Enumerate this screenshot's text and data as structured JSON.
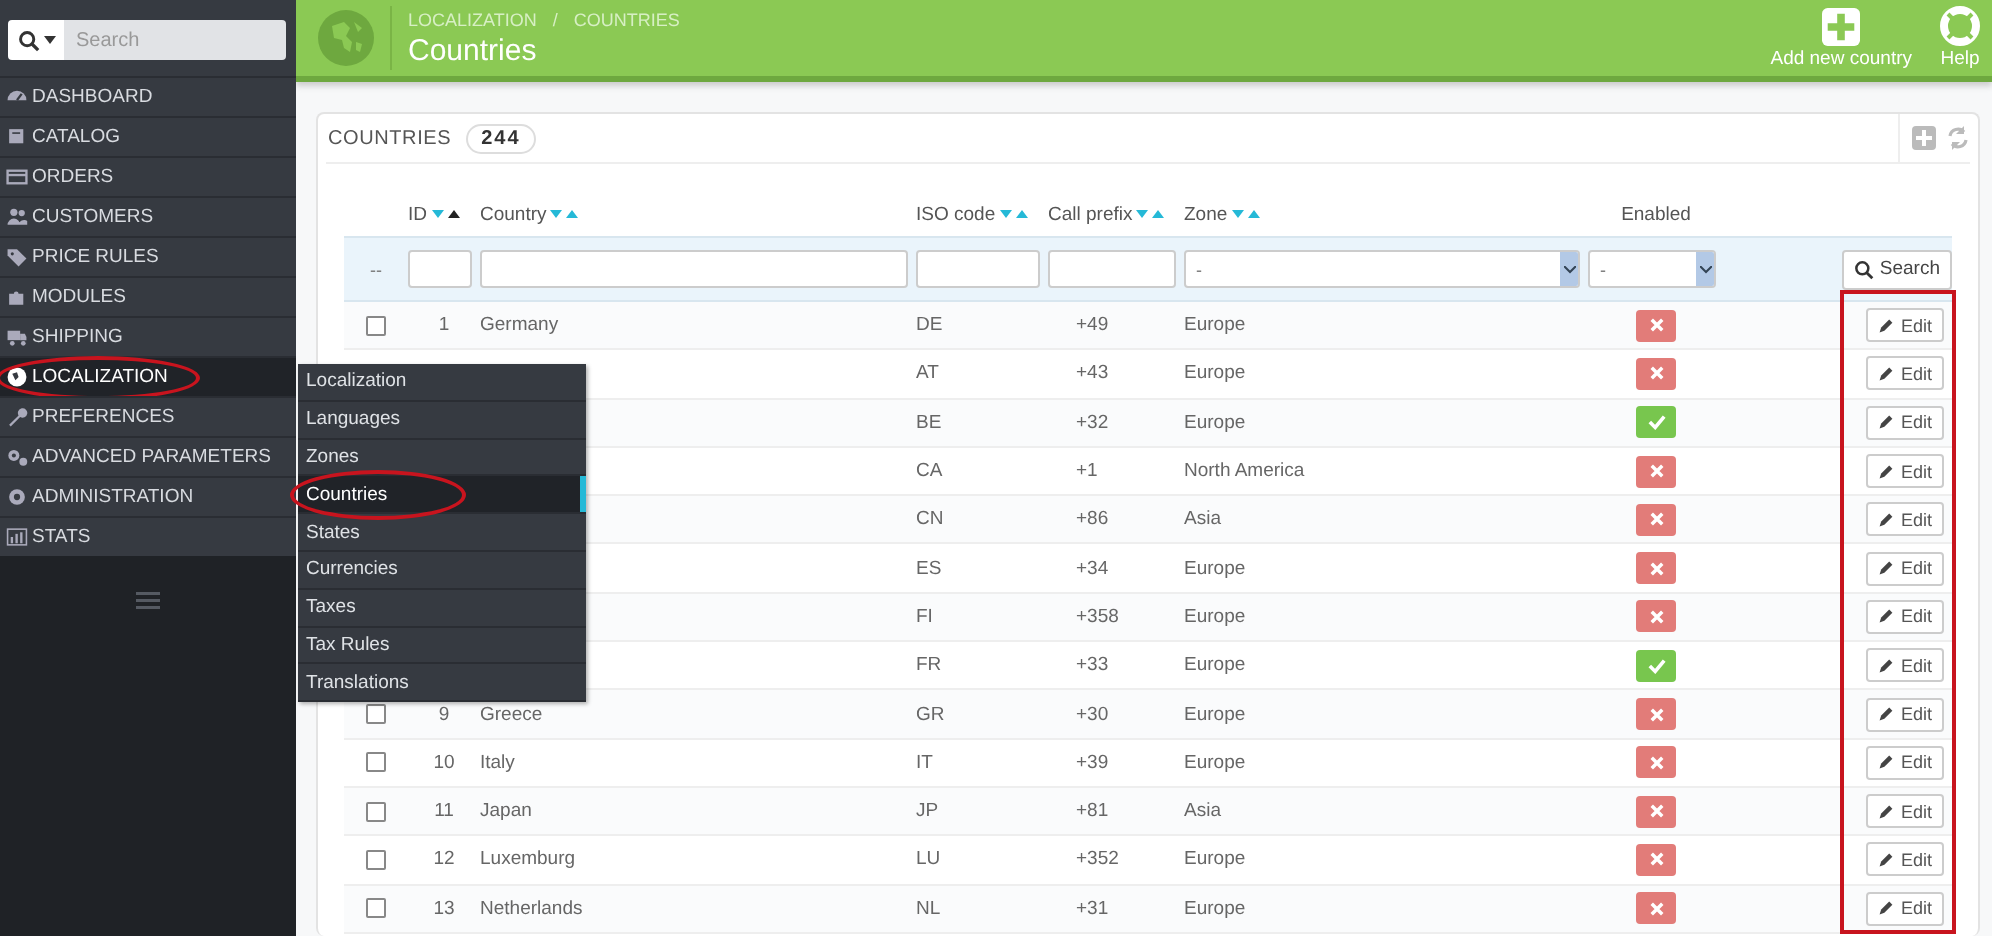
{
  "sidebar": {
    "search": {
      "placeholder": "Search"
    },
    "items": [
      {
        "label": "DASHBOARD",
        "selected": false,
        "circled": false
      },
      {
        "label": "CATALOG",
        "selected": false,
        "circled": false
      },
      {
        "label": "ORDERS",
        "selected": false,
        "circled": false
      },
      {
        "label": "CUSTOMERS",
        "selected": false,
        "circled": false
      },
      {
        "label": "PRICE RULES",
        "selected": false,
        "circled": false
      },
      {
        "label": "MODULES",
        "selected": false,
        "circled": false
      },
      {
        "label": "SHIPPING",
        "selected": false,
        "circled": false
      },
      {
        "label": "LOCALIZATION",
        "selected": true,
        "circled": true
      },
      {
        "label": "PREFERENCES",
        "selected": false,
        "circled": false
      },
      {
        "label": "ADVANCED PARAMETERS",
        "selected": false,
        "circled": false
      },
      {
        "label": "ADMINISTRATION",
        "selected": false,
        "circled": false
      },
      {
        "label": "STATS",
        "selected": false,
        "circled": false
      }
    ]
  },
  "submenu": {
    "items": [
      {
        "label": "Localization",
        "selected": false,
        "circled": false
      },
      {
        "label": "Languages",
        "selected": false,
        "circled": false
      },
      {
        "label": "Zones",
        "selected": false,
        "circled": false
      },
      {
        "label": "Countries",
        "selected": true,
        "circled": true
      },
      {
        "label": "States",
        "selected": false,
        "circled": false
      },
      {
        "label": "Currencies",
        "selected": false,
        "circled": false
      },
      {
        "label": "Taxes",
        "selected": false,
        "circled": false
      },
      {
        "label": "Tax Rules",
        "selected": false,
        "circled": false
      },
      {
        "label": "Translations",
        "selected": false,
        "circled": false
      }
    ]
  },
  "header": {
    "breadcrumb": [
      "LOCALIZATION",
      "COUNTRIES"
    ],
    "separator": "/",
    "title": "Countries",
    "toolbar": [
      {
        "kind": "add",
        "label": "Add new country"
      },
      {
        "kind": "help",
        "label": "Help"
      }
    ]
  },
  "panel": {
    "title": "COUNTRIES",
    "count": "244",
    "columns": [
      {
        "label": "ID",
        "sort_ascending": true
      },
      {
        "label": "Country",
        "sort_ascending": false
      },
      {
        "label": "ISO code",
        "sort_ascending": false
      },
      {
        "label": "Call prefix",
        "sort_ascending": false
      },
      {
        "label": "Zone",
        "sort_ascending": false
      },
      {
        "label": "Enabled"
      }
    ],
    "filters": {
      "marker": "--",
      "zone": "-",
      "enabled": "-",
      "search_button": "Search"
    },
    "edit_column_framed": true,
    "rows": [
      {
        "selected": false,
        "id": "1",
        "country": "Germany",
        "iso": "DE",
        "prefix": "+49",
        "zone": "Europe",
        "enabled": false,
        "action": "Edit"
      },
      {
        "iso": "AT",
        "prefix": "+43",
        "zone": "Europe",
        "enabled": false,
        "action": "Edit"
      },
      {
        "iso": "BE",
        "prefix": "+32",
        "zone": "Europe",
        "enabled": true,
        "action": "Edit"
      },
      {
        "iso": "CA",
        "prefix": "+1",
        "zone": "North America",
        "enabled": false,
        "action": "Edit"
      },
      {
        "iso": "CN",
        "prefix": "+86",
        "zone": "Asia",
        "enabled": false,
        "action": "Edit"
      },
      {
        "iso": "ES",
        "prefix": "+34",
        "zone": "Europe",
        "enabled": false,
        "action": "Edit"
      },
      {
        "iso": "FI",
        "prefix": "+358",
        "zone": "Europe",
        "enabled": false,
        "action": "Edit"
      },
      {
        "iso": "FR",
        "prefix": "+33",
        "zone": "Europe",
        "enabled": true,
        "action": "Edit"
      },
      {
        "selected": false,
        "id": "9",
        "country": "Greece",
        "iso": "GR",
        "prefix": "+30",
        "zone": "Europe",
        "enabled": false,
        "action": "Edit"
      },
      {
        "selected": false,
        "id": "10",
        "country": "Italy",
        "iso": "IT",
        "prefix": "+39",
        "zone": "Europe",
        "enabled": false,
        "action": "Edit"
      },
      {
        "selected": false,
        "id": "11",
        "country": "Japan",
        "iso": "JP",
        "prefix": "+81",
        "zone": "Asia",
        "enabled": false,
        "action": "Edit"
      },
      {
        "selected": false,
        "id": "12",
        "country": "Luxemburg",
        "iso": "LU",
        "prefix": "+352",
        "zone": "Europe",
        "enabled": false,
        "action": "Edit"
      },
      {
        "selected": false,
        "id": "13",
        "country": "Netherlands",
        "iso": "NL",
        "prefix": "+31",
        "zone": "Europe",
        "enabled": false,
        "action": "Edit"
      }
    ]
  }
}
